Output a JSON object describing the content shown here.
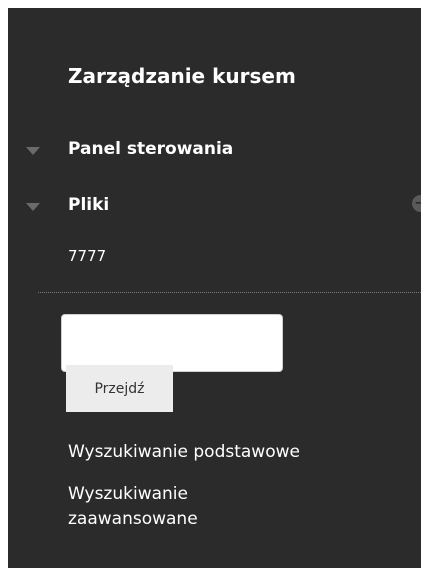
{
  "sidebar": {
    "heading": "Zarządzanie kursem",
    "sections": [
      {
        "label": "Panel sterowania",
        "expanded": true
      },
      {
        "label": "Pliki",
        "expanded": true,
        "action_icon": "arrow-circle-right-icon"
      }
    ],
    "files_item": "7777"
  },
  "search": {
    "input_value": "",
    "button_label": "Przejdź",
    "basic_link": "Wyszukiwanie podstawowe",
    "advanced_link": "Wyszukiwanie zaawansowane"
  },
  "colors": {
    "panel_background": "#2b2b2b",
    "text": "#ffffff",
    "arrow": "#6a6a6a",
    "button_background": "#ececec"
  }
}
